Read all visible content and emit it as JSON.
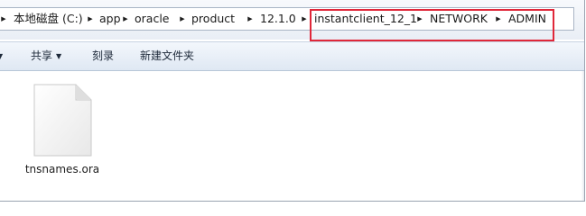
{
  "breadcrumb": {
    "items": [
      "本地磁盘 (C:)",
      "app",
      "oracle",
      "product",
      "12.1.0",
      "instantclient_12_1",
      "NETWORK",
      "ADMIN"
    ],
    "separator_icon": "right-triangle-icon"
  },
  "toolbar": {
    "share_label": "共享",
    "burn_label": "刻录",
    "new_folder_label": "新建文件夹"
  },
  "files": [
    {
      "name": "tnsnames.ora",
      "icon": "blank-document-icon"
    }
  ],
  "colors": {
    "highlight": "#e0283a",
    "toolbar_top": "#f3f7fc",
    "toolbar_bottom": "#dfe8f3"
  }
}
